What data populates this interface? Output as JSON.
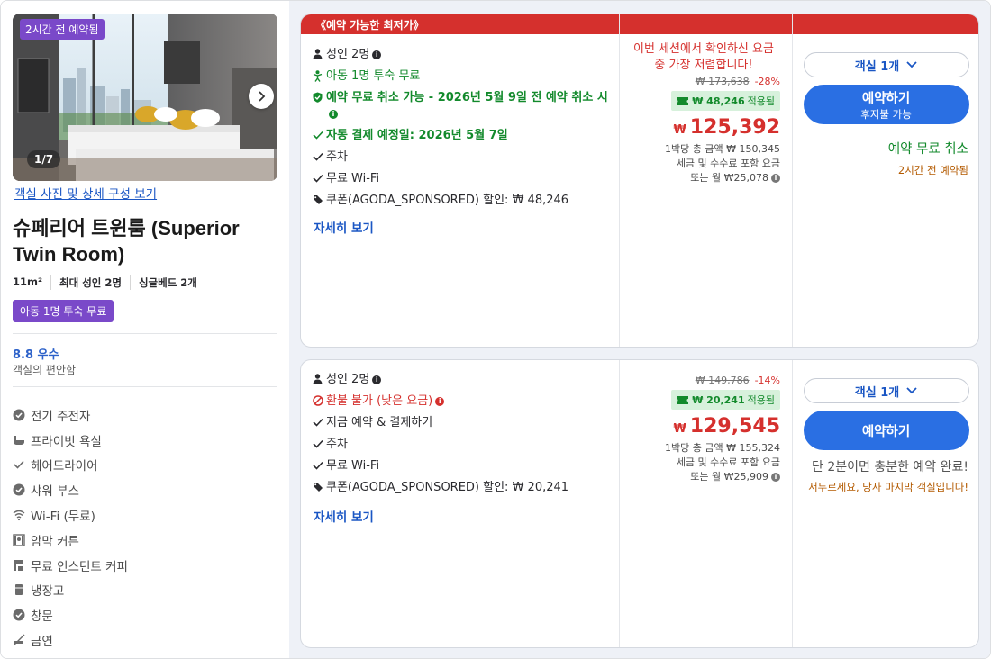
{
  "left": {
    "photo_badge": "2시간 전 예약됨",
    "photo_counter": "1/7",
    "photo_link": "객실 사진 및 상세 구성 보기",
    "room_title": "슈페리어 트윈룸 (Superior Twin Room)",
    "specs": [
      "11m²",
      "최대 성인 2명",
      "싱글베드 2개"
    ],
    "kid_badge": "아동 1명 투숙 무료",
    "score": "8.8 우수",
    "score_sub": "객실의 편안함",
    "amenities": [
      {
        "icon": "check-circle-icon",
        "label": "전기 주전자"
      },
      {
        "icon": "bathtub-icon",
        "label": "프라이빗 욕실"
      },
      {
        "icon": "check-icon",
        "label": "헤어드라이어"
      },
      {
        "icon": "check-circle-icon",
        "label": "샤워 부스"
      },
      {
        "icon": "wifi-icon",
        "label": "Wi-Fi (무료)"
      },
      {
        "icon": "blackout-curtain-icon",
        "label": "암막 커튼"
      },
      {
        "icon": "coffee-machine-icon",
        "label": "무료 인스턴트 커피"
      },
      {
        "icon": "fridge-icon",
        "label": "냉장고"
      },
      {
        "icon": "check-circle-icon",
        "label": "창문"
      },
      {
        "icon": "no-smoking-icon",
        "label": "금연"
      }
    ]
  },
  "offer1": {
    "ribbon": "《예약 가능한 최저가》",
    "features": {
      "adults": "성인 2명",
      "child": "아동 1명 투숙 무료",
      "free_cancel": "예약 무료 취소 가능 - 2026년 5월 9일 전 예약 취소 시",
      "auto_pay": "자동 결제 예정일: 2026년 5월 7일",
      "parking": "주차",
      "wifi": "무료 Wi-Fi",
      "coupon": "쿠폰(AGODA_SPONSORED) 할인: ₩ 48,246"
    },
    "more_link": "자세히 보기",
    "session_note": "이번 세션에서 확인하신 요금 중 가장 저렴합니다!",
    "old_price": "₩ 173,638",
    "discount": "-28%",
    "coupon_amount": "₩ 48,246",
    "coupon_applied": "적용됨",
    "currency": "₩",
    "price": "125,392",
    "total_line": "1박당 총 금액 ₩ 150,345",
    "tax_line": "세금 및 수수료 포함 요금",
    "monthly_line": "또는 월 ₩25,078",
    "rooms_select": "객실 1개",
    "book_label": "예약하기",
    "book_sub": "후지불 가능",
    "free_cancel_note": "예약 무료 취소",
    "booked_ago": "2시간 전 예약됨"
  },
  "offer2": {
    "features": {
      "adults": "성인 2명",
      "non_refundable": "환불 불가 (낮은 요금)",
      "pay_now": "지금 예약 & 결제하기",
      "parking": "주차",
      "wifi": "무료 Wi-Fi",
      "coupon": "쿠폰(AGODA_SPONSORED) 할인: ₩ 20,241"
    },
    "more_link": "자세히 보기",
    "old_price": "₩ 149,786",
    "discount": "-14%",
    "coupon_amount": "₩ 20,241",
    "coupon_applied": "적용됨",
    "currency": "₩",
    "price": "129,545",
    "total_line": "1박당 총 금액 ₩ 155,324",
    "tax_line": "세금 및 수수료 포함 요금",
    "monthly_line": "또는 월 ₩25,909",
    "rooms_select": "객실 1개",
    "book_label": "예약하기",
    "hurry_main": "단 2분이면 충분한 예약 완료!",
    "hurry_sub": "서두르세요, 당사 마지막 객실입니다!"
  },
  "colors": {
    "accent_blue": "#2a6fe3",
    "link_blue": "#1a56c4",
    "price_red": "#d5302d",
    "success_green": "#138a2c",
    "badge_purple": "#7a49c9"
  }
}
